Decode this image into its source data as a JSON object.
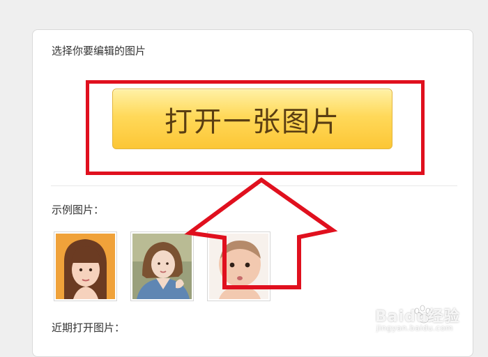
{
  "panel": {
    "prompt": "选择你要编辑的图片",
    "open_button_label": "打开一张图片",
    "samples_label": "示例图片：",
    "recent_label": "近期打开图片："
  },
  "samples": [
    {
      "name": "sample-photo-woman-bangs"
    },
    {
      "name": "sample-photo-woman-denim"
    },
    {
      "name": "sample-photo-baby"
    }
  ],
  "annotation": {
    "highlight_color": "#e0101e",
    "arrow_color": "#e0101e",
    "arrow_direction": "up"
  },
  "watermark": {
    "brand": "Baidu经验",
    "url": "jingyan.baidu.com"
  },
  "colors": {
    "button_top": "#fff1a6",
    "button_bottom": "#fcc635",
    "button_text": "#5a3e12",
    "page_bg": "#efefef"
  }
}
